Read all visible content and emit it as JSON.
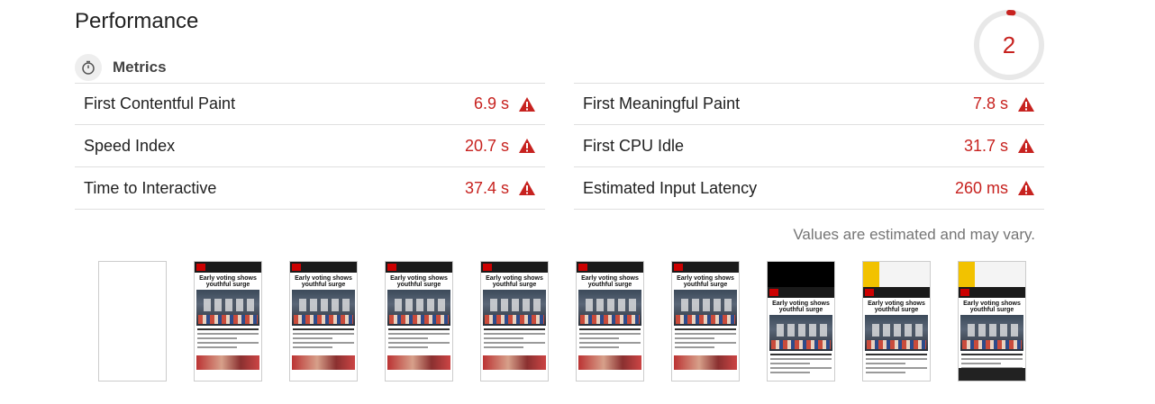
{
  "section": {
    "title": "Performance"
  },
  "score": {
    "value": "2",
    "fraction": 0.02,
    "color": "#c7221f"
  },
  "metrics_header": {
    "icon": "stopwatch-icon",
    "label": "Metrics"
  },
  "metrics": {
    "left": [
      {
        "label": "First Contentful Paint",
        "value": "6.9 s",
        "status": "fail"
      },
      {
        "label": "Speed Index",
        "value": "20.7 s",
        "status": "fail"
      },
      {
        "label": "Time to Interactive",
        "value": "37.4 s",
        "status": "fail"
      }
    ],
    "right": [
      {
        "label": "First Meaningful Paint",
        "value": "7.8 s",
        "status": "fail"
      },
      {
        "label": "First CPU Idle",
        "value": "31.7 s",
        "status": "fail"
      },
      {
        "label": "Estimated Input Latency",
        "value": "260 ms",
        "status": "fail"
      }
    ]
  },
  "disclaimer": "Values are estimated and may vary.",
  "colors": {
    "fail": "#c7221f",
    "text": "#212121",
    "muted": "#757575",
    "divider": "#e0e0e0"
  },
  "filmstrip": {
    "headline": "Early voting shows youthful surge",
    "frames": [
      "blank",
      "page",
      "page",
      "page",
      "page",
      "page",
      "page-light",
      "page-dark",
      "page-ad",
      "page-ad-cookie"
    ]
  }
}
